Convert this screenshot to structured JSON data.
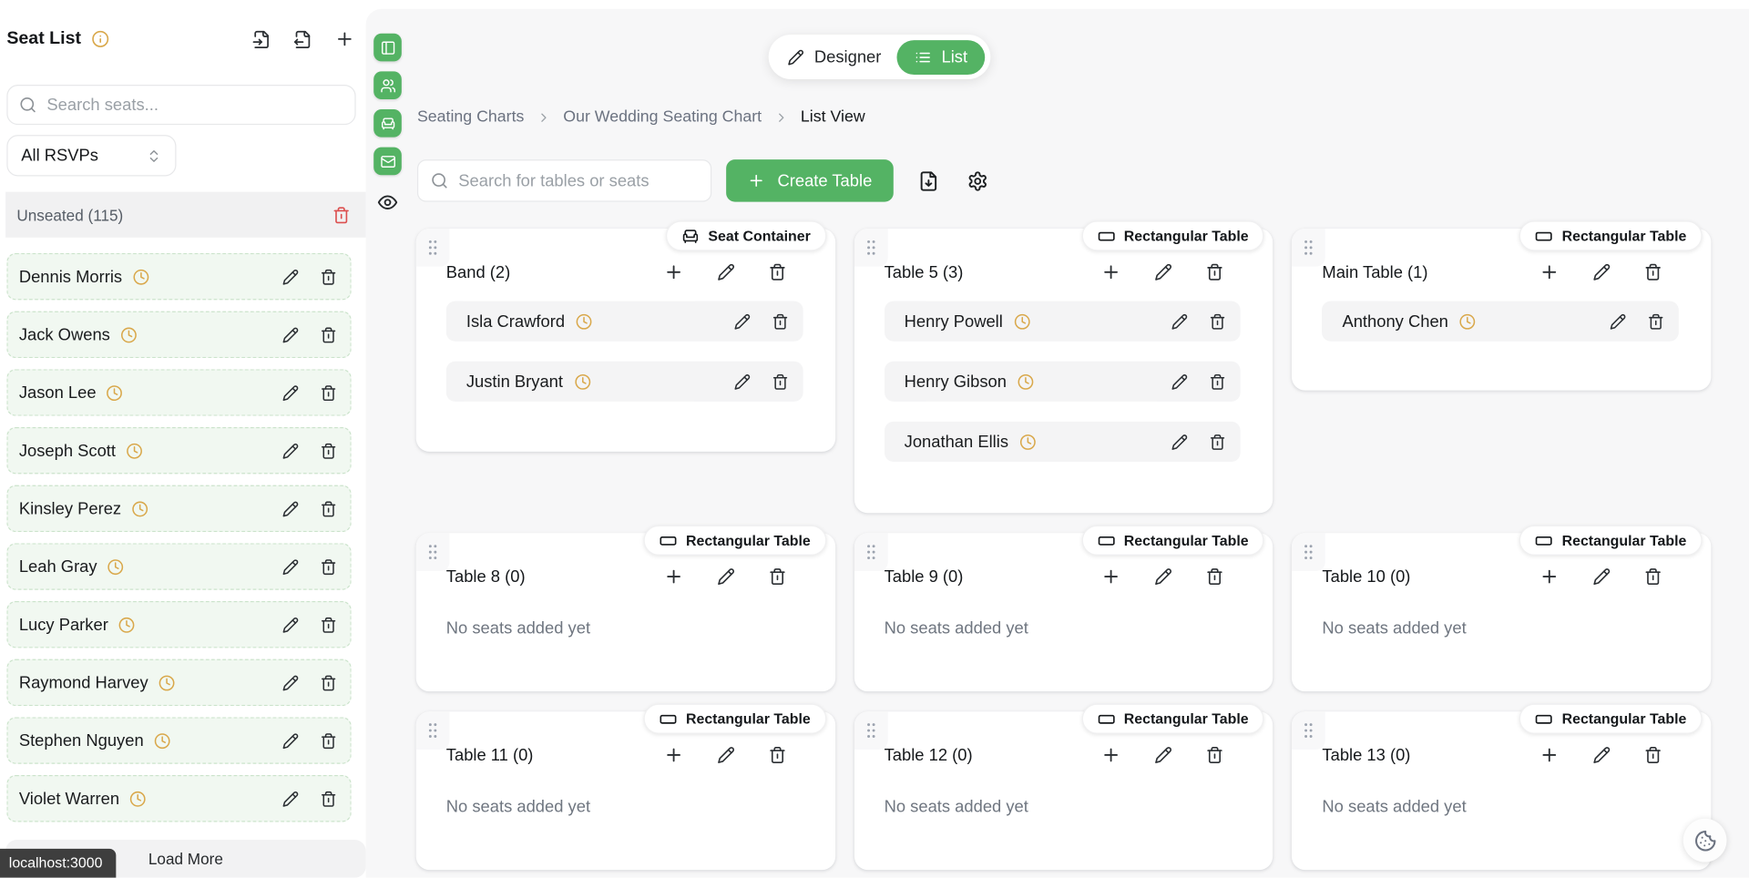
{
  "sidebar": {
    "title": "Seat List",
    "search_placeholder": "Search seats...",
    "rsvp_filter_value": "All RSVPs",
    "unseated_label": "Unseated (115)",
    "guests": [
      "Dennis Morris",
      "Jack Owens",
      "Jason Lee",
      "Joseph Scott",
      "Kinsley Perez",
      "Leah Gray",
      "Lucy Parker",
      "Raymond Harvey",
      "Stephen Nguyen",
      "Violet Warren"
    ],
    "load_more_label": "Load More"
  },
  "view_toggle": {
    "designer_label": "Designer",
    "list_label": "List"
  },
  "breadcrumb": {
    "items": [
      "Seating Charts",
      "Our Wedding Seating Chart",
      "List View"
    ]
  },
  "toolbar": {
    "search_placeholder": "Search for tables or seats",
    "create_table_label": "Create Table"
  },
  "tables": [
    {
      "title": "Band (2)",
      "type_label": "Seat Container",
      "seats": [
        "Isla Crawford",
        "Justin Bryant"
      ]
    },
    {
      "title": "Table 5 (3)",
      "type_label": "Rectangular Table",
      "seats": [
        "Henry Powell",
        "Henry Gibson",
        "Jonathan Ellis"
      ]
    },
    {
      "title": "Main Table (1)",
      "type_label": "Rectangular Table",
      "seats": [
        "Anthony Chen"
      ]
    },
    {
      "title": "Table 8 (0)",
      "type_label": "Rectangular Table",
      "seats": []
    },
    {
      "title": "Table 9 (0)",
      "type_label": "Rectangular Table",
      "seats": []
    },
    {
      "title": "Table 10 (0)",
      "type_label": "Rectangular Table",
      "seats": []
    },
    {
      "title": "Table 11 (0)",
      "type_label": "Rectangular Table",
      "seats": []
    },
    {
      "title": "Table 12 (0)",
      "type_label": "Rectangular Table",
      "seats": []
    },
    {
      "title": "Table 13 (0)",
      "type_label": "Rectangular Table",
      "seats": []
    }
  ],
  "empty_table_text": "No seats added yet",
  "status": {
    "url_tooltip": "localhost:3000"
  },
  "icons": {
    "sidebar_header": [
      "info-icon",
      "import-icon",
      "export-icon",
      "add-seat-icon"
    ],
    "left_toolbar": [
      "panel-left-icon",
      "users-icon",
      "armchair-icon",
      "mail-icon",
      "eye-icon"
    ],
    "toolbar": [
      "search-icon",
      "plus-icon",
      "file-download-icon",
      "gear-icon"
    ],
    "row_actions": [
      "clock-icon",
      "pencil-icon",
      "trash-icon"
    ],
    "misc": [
      "grip-icon",
      "chevrons-up-down-icon",
      "chevron-right-icon",
      "cookie-icon",
      "list-icon",
      "rectangle-table-icon"
    ]
  },
  "colors": {
    "accent_green": "#54b364",
    "warning_amber": "#d9a84b",
    "danger_red": "#dc4f4f",
    "panel_bg": "#f7f7f8",
    "guest_row_bg": "#f1f8f1",
    "seat_row_bg": "#f4f4f5"
  }
}
